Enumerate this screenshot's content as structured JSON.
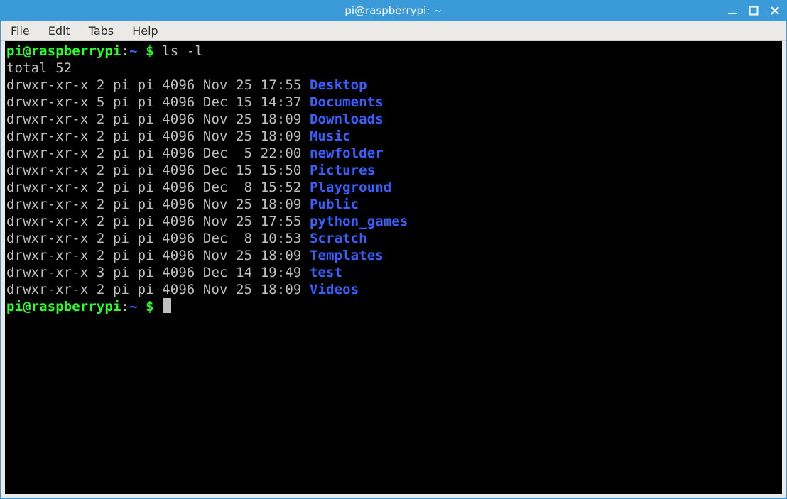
{
  "window": {
    "title": "pi@raspberrypi: ~"
  },
  "menubar": {
    "items": [
      "File",
      "Edit",
      "Tabs",
      "Help"
    ]
  },
  "prompt": {
    "userhost": "pi@raspberrypi",
    "colon": ":",
    "path": "~",
    "dollar": " $ "
  },
  "command": "ls -l",
  "total_label": "total 52",
  "listing": [
    {
      "perm": "drwxr-xr-x",
      "links": "2",
      "owner": "pi",
      "group": "pi",
      "size": "4096",
      "month": "Nov",
      "day": "25",
      "time": "17:55",
      "name": "Desktop"
    },
    {
      "perm": "drwxr-xr-x",
      "links": "5",
      "owner": "pi",
      "group": "pi",
      "size": "4096",
      "month": "Dec",
      "day": "15",
      "time": "14:37",
      "name": "Documents"
    },
    {
      "perm": "drwxr-xr-x",
      "links": "2",
      "owner": "pi",
      "group": "pi",
      "size": "4096",
      "month": "Nov",
      "day": "25",
      "time": "18:09",
      "name": "Downloads"
    },
    {
      "perm": "drwxr-xr-x",
      "links": "2",
      "owner": "pi",
      "group": "pi",
      "size": "4096",
      "month": "Nov",
      "day": "25",
      "time": "18:09",
      "name": "Music"
    },
    {
      "perm": "drwxr-xr-x",
      "links": "2",
      "owner": "pi",
      "group": "pi",
      "size": "4096",
      "month": "Dec",
      "day": " 5",
      "time": "22:00",
      "name": "newfolder"
    },
    {
      "perm": "drwxr-xr-x",
      "links": "2",
      "owner": "pi",
      "group": "pi",
      "size": "4096",
      "month": "Dec",
      "day": "15",
      "time": "15:50",
      "name": "Pictures"
    },
    {
      "perm": "drwxr-xr-x",
      "links": "2",
      "owner": "pi",
      "group": "pi",
      "size": "4096",
      "month": "Dec",
      "day": " 8",
      "time": "15:52",
      "name": "Playground"
    },
    {
      "perm": "drwxr-xr-x",
      "links": "2",
      "owner": "pi",
      "group": "pi",
      "size": "4096",
      "month": "Nov",
      "day": "25",
      "time": "18:09",
      "name": "Public"
    },
    {
      "perm": "drwxr-xr-x",
      "links": "2",
      "owner": "pi",
      "group": "pi",
      "size": "4096",
      "month": "Nov",
      "day": "25",
      "time": "17:55",
      "name": "python_games"
    },
    {
      "perm": "drwxr-xr-x",
      "links": "2",
      "owner": "pi",
      "group": "pi",
      "size": "4096",
      "month": "Dec",
      "day": " 8",
      "time": "10:53",
      "name": "Scratch"
    },
    {
      "perm": "drwxr-xr-x",
      "links": "2",
      "owner": "pi",
      "group": "pi",
      "size": "4096",
      "month": "Nov",
      "day": "25",
      "time": "18:09",
      "name": "Templates"
    },
    {
      "perm": "drwxr-xr-x",
      "links": "3",
      "owner": "pi",
      "group": "pi",
      "size": "4096",
      "month": "Dec",
      "day": "14",
      "time": "19:49",
      "name": "test"
    },
    {
      "perm": "drwxr-xr-x",
      "links": "2",
      "owner": "pi",
      "group": "pi",
      "size": "4096",
      "month": "Nov",
      "day": "25",
      "time": "18:09",
      "name": "Videos"
    }
  ]
}
